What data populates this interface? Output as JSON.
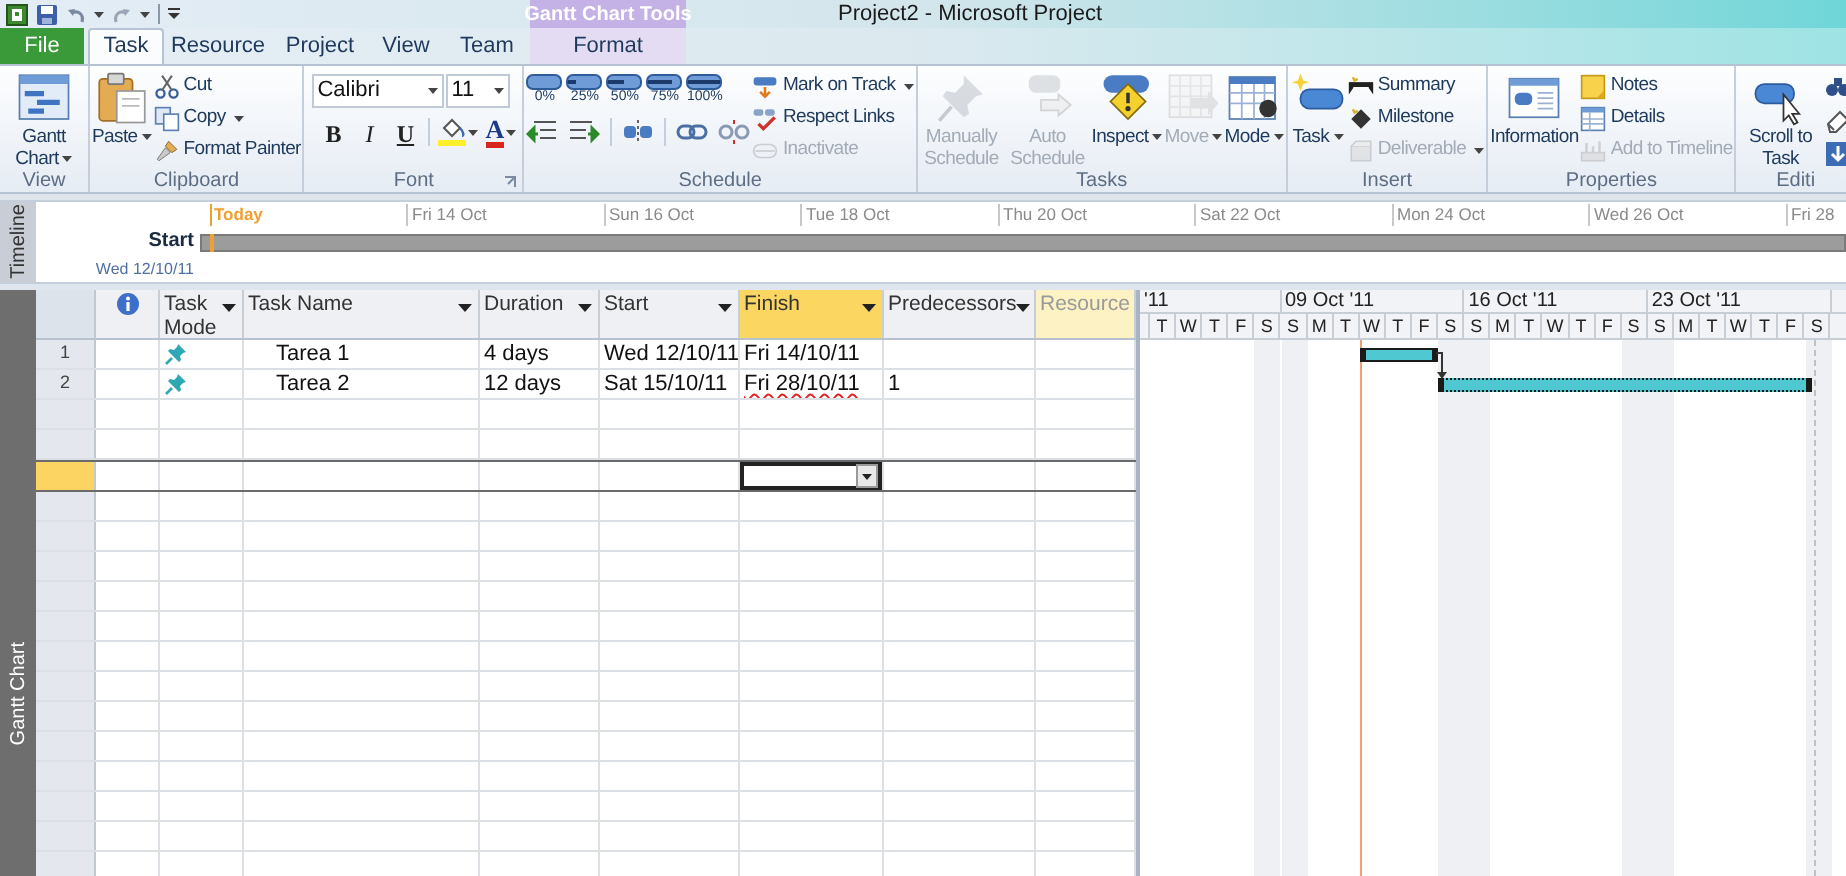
{
  "title_bar": {
    "title": "Project2 - Microsoft Project",
    "contextual_group": "Gantt Chart Tools"
  },
  "tabs": [
    {
      "label": "File",
      "kind": "file",
      "selected": false
    },
    {
      "label": "Task",
      "kind": "normal",
      "selected": true
    },
    {
      "label": "Resource",
      "kind": "normal",
      "selected": false
    },
    {
      "label": "Project",
      "kind": "normal",
      "selected": false
    },
    {
      "label": "View",
      "kind": "normal",
      "selected": false
    },
    {
      "label": "Team",
      "kind": "normal",
      "selected": false
    },
    {
      "label": "Format",
      "kind": "contextual",
      "selected": false
    }
  ],
  "ribbon": {
    "groups": [
      {
        "label": "View",
        "items": [
          {
            "kind": "large",
            "label": "Gantt Chart",
            "has_menu": true,
            "disabled": false
          }
        ]
      },
      {
        "label": "Clipboard",
        "items": [
          {
            "kind": "large",
            "label": "Paste",
            "has_menu": true,
            "disabled": false
          },
          {
            "kind": "stack",
            "items": [
              {
                "label": "Cut",
                "has_menu": false,
                "disabled": false
              },
              {
                "label": "Copy",
                "has_menu": true,
                "disabled": false
              },
              {
                "label": "Format Painter",
                "has_menu": false,
                "disabled": false
              }
            ]
          }
        ]
      },
      {
        "label": "Font",
        "items": [
          {
            "kind": "font",
            "font": "Calibri",
            "size": "11",
            "styles": [
              "B",
              "I",
              "U"
            ],
            "color_glyph": "A"
          }
        ]
      },
      {
        "label": "Schedule",
        "items": [
          {
            "kind": "schedule",
            "percents": [
              "0%",
              "25%",
              "50%",
              "75%",
              "100%"
            ]
          },
          {
            "kind": "stack",
            "items": [
              {
                "label": "Mark on Track",
                "has_menu": true,
                "disabled": false
              },
              {
                "label": "Respect Links",
                "has_menu": false,
                "disabled": false
              },
              {
                "label": "Inactivate",
                "has_menu": false,
                "disabled": true
              }
            ]
          }
        ]
      },
      {
        "label": "Tasks",
        "items": [
          {
            "kind": "large",
            "label": "Manually Schedule",
            "has_menu": false,
            "disabled": true
          },
          {
            "kind": "large",
            "label": "Auto Schedule",
            "has_menu": false,
            "disabled": true
          },
          {
            "kind": "large",
            "label": "Inspect",
            "has_menu": true,
            "disabled": false
          },
          {
            "kind": "large",
            "label": "Move",
            "has_menu": true,
            "disabled": true
          },
          {
            "kind": "large",
            "label": "Mode",
            "has_menu": true,
            "disabled": false
          }
        ]
      },
      {
        "label": "Insert",
        "items": [
          {
            "kind": "large",
            "label": "Task",
            "has_menu": true,
            "disabled": false
          },
          {
            "kind": "stack",
            "items": [
              {
                "label": "Summary",
                "has_menu": false,
                "disabled": false
              },
              {
                "label": "Milestone",
                "has_menu": false,
                "disabled": false
              },
              {
                "label": "Deliverable",
                "has_menu": true,
                "disabled": true
              }
            ]
          }
        ]
      },
      {
        "label": "Properties",
        "items": [
          {
            "kind": "large",
            "label": "Information",
            "has_menu": false,
            "disabled": false
          },
          {
            "kind": "stack",
            "items": [
              {
                "label": "Notes",
                "has_menu": false,
                "disabled": false
              },
              {
                "label": "Details",
                "has_menu": false,
                "disabled": false
              },
              {
                "label": "Add to Timeline",
                "has_menu": false,
                "disabled": true
              }
            ]
          }
        ]
      },
      {
        "label": "Editi",
        "items": [
          {
            "kind": "large",
            "label": "Scroll to Task",
            "has_menu": false,
            "disabled": false
          },
          {
            "kind": "icon_stack"
          }
        ]
      }
    ]
  },
  "timeline": {
    "side_label": "Timeline",
    "start_label": "Start",
    "start_date": "Wed 12/10/11",
    "today_label": "Today",
    "dates": [
      "Fri 14 Oct",
      "Sun 16 Oct",
      "Tue 18 Oct",
      "Thu 20 Oct",
      "Sat 22 Oct",
      "Mon 24 Oct",
      "Wed 26 Oct",
      "Fri 28"
    ]
  },
  "view_bar": {
    "label": "Gantt Chart"
  },
  "table": {
    "columns": [
      {
        "kind": "info",
        "selected": false,
        "hovered": false
      },
      {
        "kind": "text",
        "label": "Task Mode",
        "has_menu": true,
        "selected": false,
        "hovered": false
      },
      {
        "kind": "text",
        "label": "Task Name",
        "has_menu": true,
        "selected": false,
        "hovered": false
      },
      {
        "kind": "text",
        "label": "Duration",
        "has_menu": true,
        "selected": false,
        "hovered": false
      },
      {
        "kind": "text",
        "label": "Start",
        "has_menu": true,
        "selected": false,
        "hovered": false
      },
      {
        "kind": "text",
        "label": "Finish",
        "has_menu": true,
        "selected": true,
        "hovered": false
      },
      {
        "kind": "text",
        "label": "Predecessors",
        "has_menu": true,
        "selected": false,
        "hovered": false
      },
      {
        "kind": "text",
        "label": "Resource",
        "has_menu": false,
        "selected": false,
        "hovered": true
      }
    ],
    "rows": [
      {
        "id": "1",
        "manually_scheduled": true,
        "name": "Tarea 1",
        "duration": "4 days",
        "start": "Wed 12/10/11",
        "finish": "Fri 14/10/11",
        "spell_error": false,
        "selected": false
      },
      {
        "id": "2",
        "manually_scheduled": true,
        "name": "Tarea 2",
        "duration": "12 days",
        "start": "Sat 15/10/11",
        "finish": "Fri 28/10/11",
        "spell_error": true,
        "predecessors": "1",
        "selected": false
      },
      {
        "selected": false
      },
      {
        "selected": false
      },
      {
        "selected": true
      }
    ]
  },
  "gantt": {
    "weeks": [
      "'11",
      "09 Oct '11",
      "16 Oct '11",
      "23 Oct '11"
    ],
    "days": [
      "T",
      "W",
      "T",
      "F",
      "S",
      "S",
      "M",
      "T",
      "W",
      "T",
      "F",
      "S",
      "S",
      "M",
      "T",
      "W",
      "T",
      "F",
      "S",
      "S",
      "M",
      "T",
      "W",
      "T",
      "F",
      "S"
    ]
  }
}
